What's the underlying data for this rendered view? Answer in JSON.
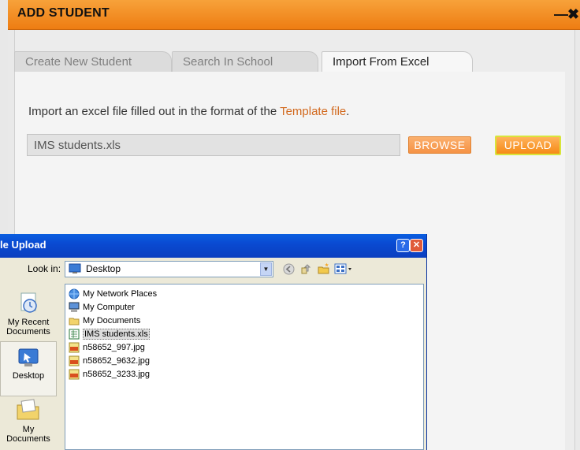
{
  "window": {
    "title": "ADD STUDENT",
    "minimize_glyph": "—",
    "close_glyph": "✖"
  },
  "tabs": [
    {
      "label": "Create New Student",
      "active": false
    },
    {
      "label": "Search In School",
      "active": false
    },
    {
      "label": "Import From Excel",
      "active": true
    }
  ],
  "import": {
    "instruction_prefix": "Import an excel file filled out in the format of the ",
    "template_link": "Template file",
    "instruction_suffix": ".",
    "file_value": "IMS students.xls",
    "browse_label": "BROWSE",
    "upload_label": "UPLOAD"
  },
  "dialog": {
    "title": "le Upload",
    "help_glyph": "?",
    "close_glyph": "✕",
    "look_in_label": "Look in:",
    "look_in_value": "Desktop",
    "places": [
      {
        "label": "My Recent Documents",
        "icon": "recent-documents-icon"
      },
      {
        "label": "Desktop",
        "icon": "desktop-icon",
        "selected": true
      },
      {
        "label": "My Documents",
        "icon": "my-documents-icon"
      }
    ],
    "files": [
      {
        "name": "My Network Places",
        "icon": "network-places-icon"
      },
      {
        "name": "My Computer",
        "icon": "my-computer-icon"
      },
      {
        "name": "My Documents",
        "icon": "folder-icon"
      },
      {
        "name": "IMS students.xls",
        "icon": "excel-file-icon",
        "selected": true
      },
      {
        "name": "n58652_997.jpg",
        "icon": "jpeg-file-icon"
      },
      {
        "name": "n58652_9632.jpg",
        "icon": "jpeg-file-icon"
      },
      {
        "name": "n58652_3233.jpg",
        "icon": "jpeg-file-icon"
      }
    ]
  },
  "colors": {
    "title_bar": "#f29024",
    "link": "#d2691e",
    "xp_title": "#0a4ad2"
  }
}
